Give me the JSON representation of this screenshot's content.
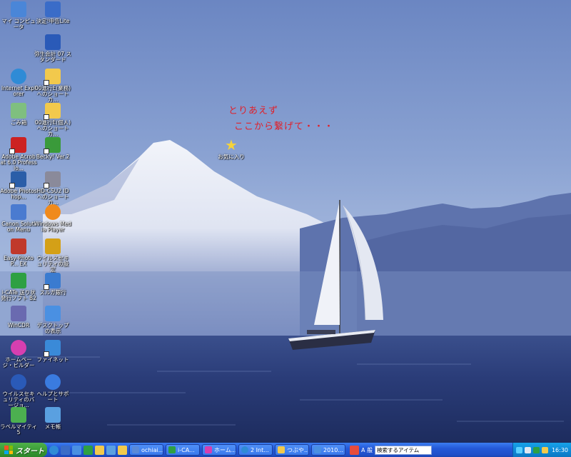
{
  "desktop_icons": [
    {
      "id": "my-computer",
      "label": "マイ コンピュータ",
      "color": "#4a86d8"
    },
    {
      "id": "tax-return",
      "label": "決定!申告Lite",
      "color": "#3a6cc8"
    },
    {
      "id": "yayoi-accounting",
      "label": "弥生会計 07 スタンダード",
      "color": "#2a5ab8"
    },
    {
      "id": "internet-explorer",
      "label": "Internet Explorer",
      "color": "#2f8bd6"
    },
    {
      "id": "folder-work",
      "label": "00進行E(業務) へのショートカ...",
      "color": "#f2c94c"
    },
    {
      "id": "recycle-bin",
      "label": "ごみ箱",
      "color": "#7fbf7f"
    },
    {
      "id": "folder-personal",
      "label": "00進行E(個人) へのショートカ...",
      "color": "#f2c94c"
    },
    {
      "id": "adobe-acrobat",
      "label": "Adobe Acrobat 6.0 Professio...",
      "color": "#cc2222"
    },
    {
      "id": "becky",
      "label": "Becky! Ver.2",
      "color": "#3a9a3a"
    },
    {
      "id": "adobe-photoshop",
      "label": "Adobe Photoshop...",
      "color": "#2b5ea8"
    },
    {
      "id": "hd-cs",
      "label": "HD-CSU2 ID へのショートカ...",
      "color": "#8a8a9a"
    },
    {
      "id": "canon-solution",
      "label": "Canon Solution Menu",
      "color": "#4a7bd0"
    },
    {
      "id": "windows-media-player",
      "label": "Windows Media Player",
      "color": "#f08a1c"
    },
    {
      "id": "easy-photo",
      "label": "Easy-PhotoP... EX",
      "color": "#c0392b"
    },
    {
      "id": "virus-security-settings",
      "label": "ウイルスセキュリティの設定",
      "color": "#d4a017"
    },
    {
      "id": "i-cat",
      "label": "i-CATe 送り状発行ソフト B2",
      "color": "#2ea043"
    },
    {
      "id": "suruga-bank",
      "label": "スルガ銀行",
      "color": "#3a7bd0"
    },
    {
      "id": "wincdr",
      "label": "WinCDR",
      "color": "#6a6ab0"
    },
    {
      "id": "show-desktop",
      "label": "デスクトップの表示",
      "color": "#4a90e2"
    },
    {
      "id": "homepage-builder",
      "label": "ホームページ・ビルダー",
      "color": "#d63fb0"
    },
    {
      "id": "finet",
      "label": "ファイネット",
      "color": "#3a8ad8"
    },
    {
      "id": "virus-security-version",
      "label": "ウイルスセキュリティのバージョ...",
      "color": "#2a5ab8"
    },
    {
      "id": "help-support",
      "label": "ヘルプとサポート",
      "color": "#3a7be0"
    },
    {
      "id": "label-maker",
      "label": "ラベルマイティ5",
      "color": "#4caf50"
    },
    {
      "id": "notepad",
      "label": "メモ帳",
      "color": "#5aa0e0"
    },
    {
      "id": "center-shortcut",
      "label": "お気に入り",
      "color": "#f5d33a"
    }
  ],
  "note": {
    "line1": "とりあえず",
    "line2": "ここから繋げて・・・",
    "color": "#e0202a"
  },
  "taskbar": {
    "start_label": "スタート",
    "tasks": [
      {
        "label": "ochiai...",
        "color": "#5a8ad8"
      },
      {
        "label": "i-CA...",
        "color": "#2ea043"
      },
      {
        "label": "ホーム...",
        "color": "#d63fb0"
      },
      {
        "label": "2 Int...",
        "color": "#2f8bd6"
      },
      {
        "label": "つぶや...",
        "color": "#f2c94c"
      },
      {
        "label": "2010...",
        "color": "#4a90e2"
      }
    ],
    "search_placeholder": "検索するアイテム",
    "language_indicator": "A 般",
    "clock": "16:30"
  },
  "colors": {
    "taskbar": "#2459d8",
    "start_button": "#379a33",
    "tray": "#0f8bd9"
  }
}
